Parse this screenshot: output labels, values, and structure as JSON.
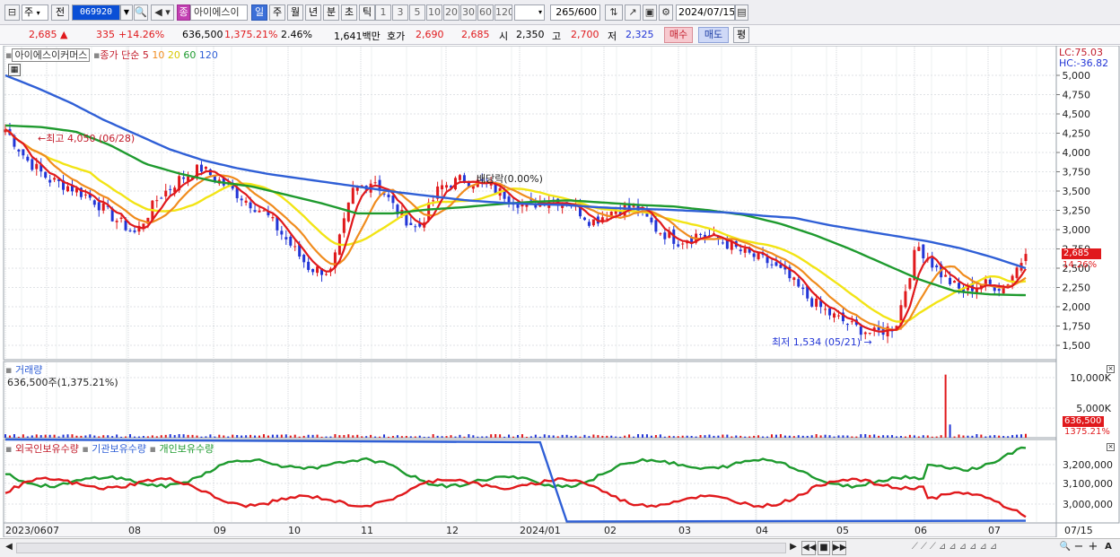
{
  "toolbar": {
    "period_label": "주",
    "prev_label": "전",
    "stock_code": "069920",
    "badge": "종",
    "stock_name": "아이에스이",
    "tabs": [
      "일",
      "주",
      "월",
      "년",
      "분",
      "초",
      "틱"
    ],
    "active_tab": "일",
    "intervals": [
      "1",
      "3",
      "5",
      "10",
      "20",
      "30",
      "60",
      "120"
    ],
    "count": "265",
    "count_total": "/600",
    "date": "2024/07/15"
  },
  "quote": {
    "price": "2,685",
    "change": "335",
    "change_pct": "+14.26%",
    "volume": "636,500",
    "volume_ratio": "1,375.21%",
    "turnover": "2.46%",
    "amount": "1,641백만",
    "hoga_label": "호가",
    "hoga1": "2,690",
    "hoga2": "2,685",
    "open_label": "시",
    "open": "2,350",
    "high_label": "고",
    "high": "2,700",
    "low_label": "저",
    "low": "2,325",
    "buy_label": "매수",
    "sell_label": "매도",
    "avg_label": "평"
  },
  "chart": {
    "legend_name": "아이에스이커머스",
    "legend_ma": "종가 단순",
    "ma_labels": [
      "5",
      "10",
      "20",
      "60",
      "120"
    ],
    "lc": "LC:75.03",
    "hc": "HC:-36.82",
    "max_label": "최고 4,050 (06/28)",
    "min_label": "최저 1,534 (05/21)",
    "dividend_label": "배당락(0.00%)",
    "last_price_label": "2,685",
    "last_pct_label": "14.26%",
    "volume_title": "거래량",
    "volume_info": "636,500주(1,375.21%)",
    "volume_last_label": "636,500",
    "volume_pct_label": "1375.21%",
    "holdings_legend": [
      "외국인보유수량",
      "기관보유수량",
      "개인보유수량"
    ],
    "price_axis": [
      "5,000",
      "4,750",
      "4,500",
      "4,250",
      "4,000",
      "3,750",
      "3,500",
      "3,250",
      "3,000",
      "2,750",
      "2,500",
      "2,250",
      "2,000",
      "1,750",
      "1,500"
    ],
    "volume_axis": [
      "10,000K",
      "5,000K"
    ],
    "holdings_axis": [
      "3,200,000",
      "3,100,000",
      "3,000,000"
    ],
    "x_labels": [
      "2023/06",
      "07",
      "08",
      "09",
      "10",
      "11",
      "12",
      "2024/01",
      "02",
      "03",
      "04",
      "05",
      "06",
      "07"
    ],
    "x_end_label": "07/15",
    "colors": {
      "ma5": "#e0191c",
      "ma10": "#f08c1e",
      "ma20": "#f2e415",
      "ma60": "#1e9a2e",
      "ma120": "#2f5fd6",
      "up": "#e0191c",
      "down": "#2235d6"
    }
  },
  "chart_data": {
    "type": "candlestick",
    "title": "아이에스이커머스",
    "x_range": [
      "2023/06",
      "2024/07/15"
    ],
    "ylim": [
      1500,
      5000
    ],
    "last_price": 2685,
    "max": {
      "value": 4050,
      "date": "06/28"
    },
    "min": {
      "value": 1534,
      "date": "05/21"
    },
    "ma120": [
      5000,
      4830,
      4640,
      4420,
      4230,
      4040,
      3900,
      3800,
      3720,
      3660,
      3600,
      3540,
      3480,
      3430,
      3380,
      3350,
      3330,
      3320,
      3290,
      3270,
      3260,
      3240,
      3220,
      3180,
      3150,
      3060,
      2990,
      2920,
      2850,
      2760,
      2640,
      2500
    ],
    "ma60": [
      4350,
      4330,
      4270,
      4090,
      3850,
      3720,
      3620,
      3560,
      3450,
      3340,
      3210,
      3210,
      3260,
      3290,
      3330,
      3360,
      3380,
      3350,
      3320,
      3300,
      3250,
      3190,
      3080,
      2930,
      2750,
      2550,
      2350,
      2200,
      2160,
      2150
    ],
    "volume": {
      "last": 636500,
      "ratio_pct": 1375.21,
      "ylim_k": [
        0,
        10000
      ]
    },
    "holdings": {
      "ylim": [
        2950000,
        3250000
      ]
    },
    "series": [
      {
        "name": "외국인보유수량"
      },
      {
        "name": "기관보유수량"
      },
      {
        "name": "개인보유수량"
      }
    ]
  },
  "scrollbar": {
    "buttons": [
      "▶",
      "◀◀",
      "■",
      "▶▶",
      "🔍",
      "−",
      "+",
      "A"
    ]
  }
}
